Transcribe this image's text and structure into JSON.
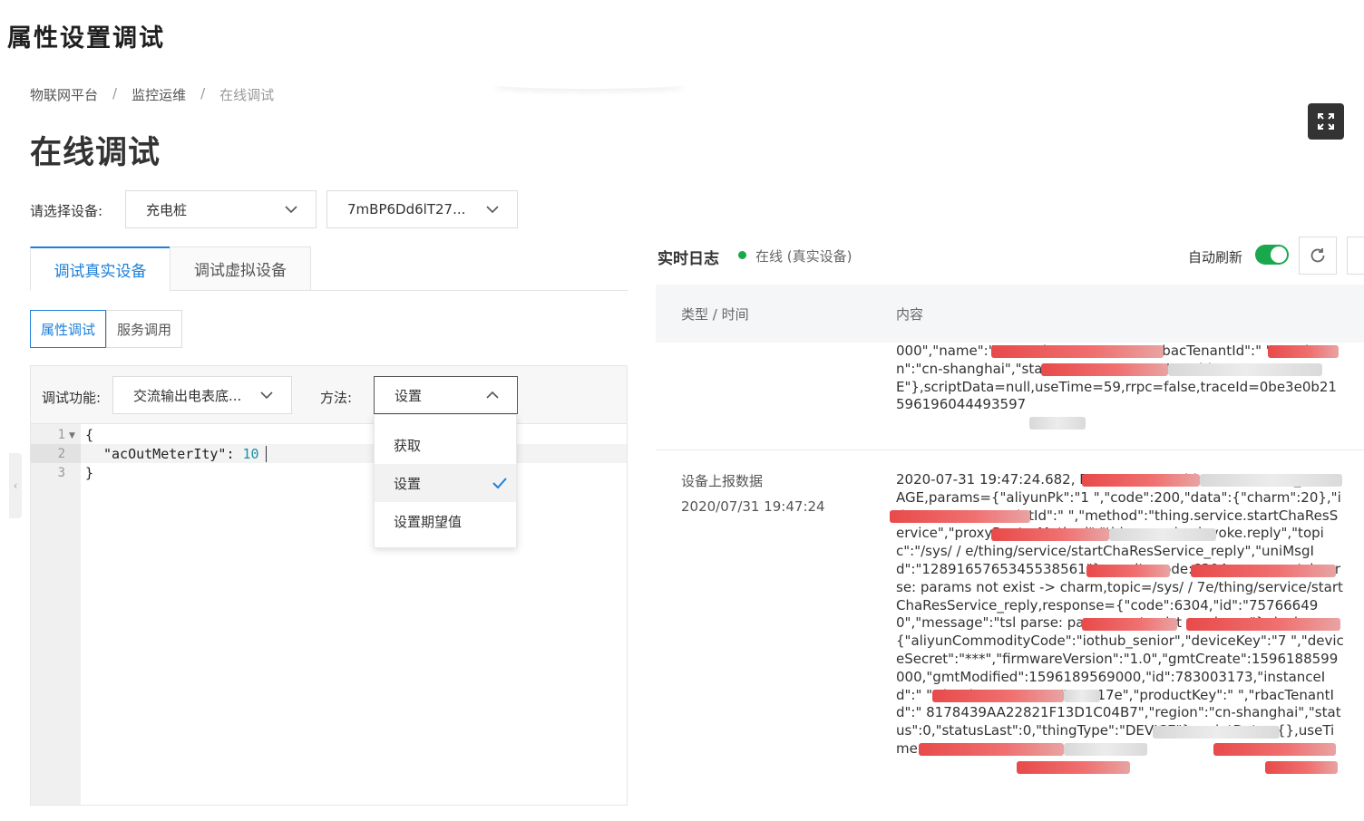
{
  "doc_title": "属性设置调试",
  "breadcrumb": [
    "物联网平台",
    "监控运维",
    "在线调试"
  ],
  "breadcrumb_sep": "/",
  "page_title": "在线调试",
  "device_select": {
    "label": "请选择设备:",
    "product": "充电桩",
    "device": "7mBP6Dd6lT27..."
  },
  "tabs": {
    "real": "调试真实设备",
    "virtual": "调试虚拟设备"
  },
  "subtabs": {
    "property": "属性调试",
    "service": "服务调用"
  },
  "debug": {
    "func_label": "调试功能:",
    "func_value": "交流输出电表底...",
    "method_label": "方法:",
    "method_value": "设置",
    "method_options": [
      "获取",
      "设置",
      "设置期望值"
    ],
    "code_lines": [
      "{",
      "\"acOutMeterIty\": ",
      "}"
    ],
    "code_value": "10",
    "line_numbers": [
      "1",
      "2",
      "3"
    ]
  },
  "log": {
    "title": "实时日志",
    "status": "在线 (真实设备)",
    "auto_refresh_label": "自动刷新",
    "auto_refresh_on": true,
    "col_type": "类型 / 时间",
    "col_content": "内容",
    "row1_content": "000\",\"name\":\"                              \",\"productKey\":\"              P37\",\"rbacTenantId\":\"                                              \",\"region\":\"cn-shanghai\",\"status\":0,\"statusLast\":0,\"thingType\":\"DEVICE\"},scriptData=null,useTime=59,rrpc=false,traceId=0be3e0b21596196044493597",
    "row2_type": "设备上报数据",
    "row2_time": "2020/07/31 19:47:24",
    "row2_content": "2020-07-31 19:47:24.682,                              B7, upstream - bizType=OTHER_MESSAGE,params={\"aliyunPk\":\"1                         \",\"code\":200,\"data\":{\"charm\":20},\"id\":\"757666490\",\"iotId\":\"                              \",\"method\":\"thing.service.startChaResService\",\"proxyRouterMethod\":\"thing.service.invoke.reply\",\"topic\":\"/sys/                /                    e/thing/service/startChaResService_reply\",\"uniMsgId\":\"1289165765345538561\"},result=code:6304,message:tsl parse: params not exist -> charm,topic=/sys/                /                   7e/thing/service/startChaResService_reply,response={\"code\":6304,\"id\":\"757666490\",\"message\":\"tsl parse: params not exist -> charm\"},device={\"aliyunCommodityCode\":\"iothub_senior\",\"deviceKey\":\"7                          \",\"deviceSecret\":\"***\",\"firmwareVersion\":\"1.0\",\"gmtCreate\":1596188599000,\"gmtModified\":1596189569000,\"id\":783003173,\"instanceId\":\"                          \",\"iotId\":\"                                        \",\"name\":\"                      qY317e\",\"productKey\":\"                        \",\"rbacTenantId\":\"              8178439AA22821F13D1C04B7\",\"region\":\"cn-shanghai\",\"status\":0,\"statusLast\":0,\"thingType\":\"DEVICE\"},scriptData={},useTime=9"
  },
  "colors": {
    "accent": "#1e80d8",
    "online": "#1aa84d",
    "redact": "#e84a4a"
  }
}
